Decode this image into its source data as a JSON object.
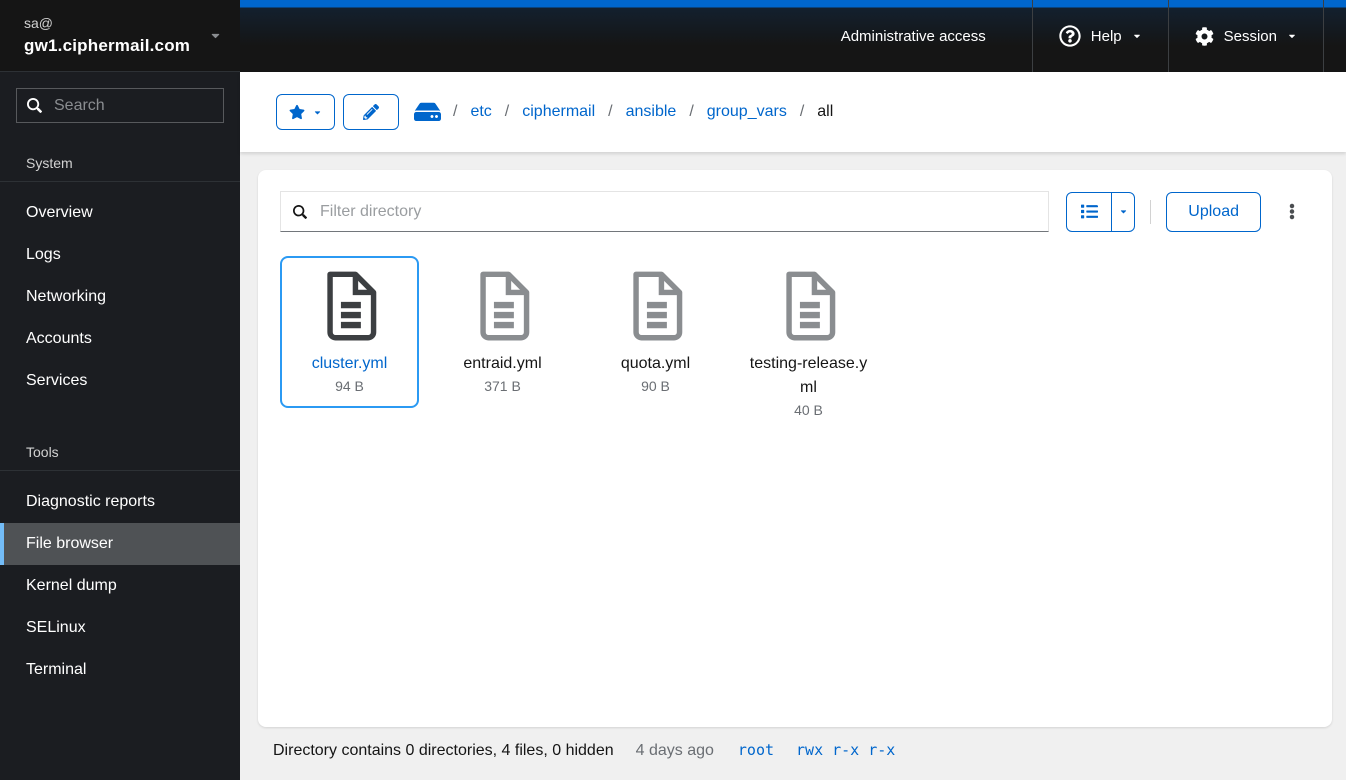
{
  "masthead": {
    "admin_access": "Administrative access",
    "help": "Help",
    "session": "Session"
  },
  "sidebar": {
    "username": "sa@",
    "hostname": "gw1.ciphermail.com",
    "search_placeholder": "Search",
    "sections": [
      {
        "title": "System",
        "items": [
          "Overview",
          "Logs",
          "Networking",
          "Accounts",
          "Services"
        ]
      },
      {
        "title": "Tools",
        "items": [
          "Diagnostic reports",
          "File browser",
          "Kernel dump",
          "SELinux",
          "Terminal"
        ]
      }
    ],
    "active_item": "File browser"
  },
  "breadcrumb": {
    "separator": "/",
    "links": [
      "etc",
      "ciphermail",
      "ansible",
      "group_vars"
    ],
    "current": "all"
  },
  "toolbar": {
    "filter_placeholder": "Filter directory",
    "upload": "Upload"
  },
  "files": [
    {
      "name": "cluster.yml",
      "size": "94 B",
      "selected": true
    },
    {
      "name": "entraid.yml",
      "size": "371 B",
      "selected": false
    },
    {
      "name": "quota.yml",
      "size": "90 B",
      "selected": false
    },
    {
      "name": "testing-release.yml",
      "size": "40 B",
      "selected": false
    }
  ],
  "footer": {
    "summary": "Directory contains 0 directories, 4 files, 0 hidden",
    "modified": "4 days ago",
    "owner": "root",
    "perm_owner": "rwx",
    "perm_group": "r-x",
    "perm_other": "r-x"
  },
  "icons": {
    "host_switcher": "caret-down-icon",
    "sidebar_search": "search-icon",
    "help": "question-circle-icon",
    "session": "gear-icon",
    "bookmarks": "star-icon",
    "edit_path": "pencil-icon",
    "filesystem_root": "hard-drive-icon",
    "filter": "search-icon",
    "view_mode": "list-icon",
    "more_actions": "kebab-vertical-icon",
    "file": "document-icon"
  },
  "colors": {
    "accent": "#0066cc",
    "selected_card_border": "#2b9af3",
    "nav_active_indicator": "#73bcf7",
    "masthead_bg": "#151515",
    "sidebar_bg": "#1b1d21",
    "content_bg": "#f0f0f0"
  }
}
